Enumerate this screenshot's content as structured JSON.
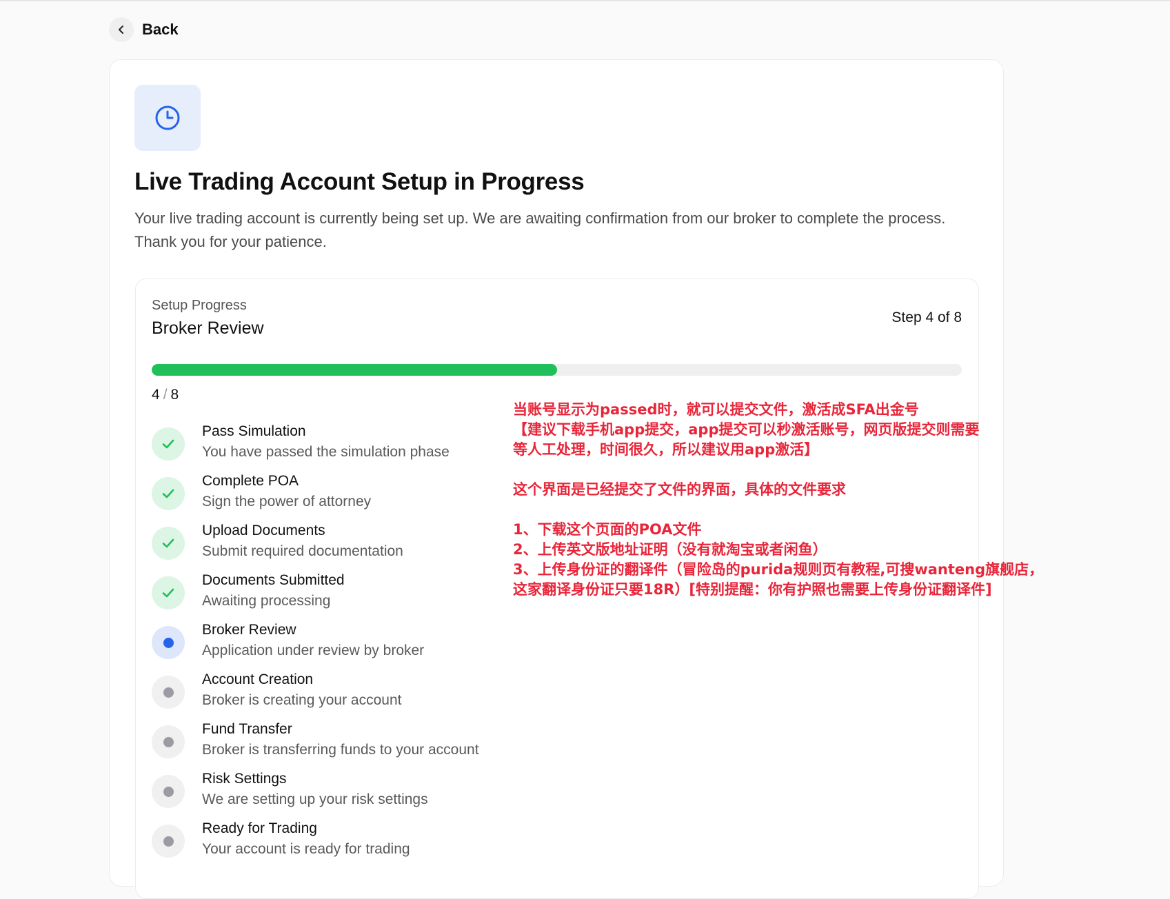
{
  "back": {
    "label": "Back"
  },
  "header": {
    "title": "Live Trading Account Setup in Progress",
    "description": "Your live trading account is currently being set up. We are awaiting confirmation from our broker to complete the process. Thank you for your patience."
  },
  "progress": {
    "label": "Setup Progress",
    "current_stage": "Broker Review",
    "step_text": "Step 4 of 8",
    "current": "4",
    "separator": "/",
    "total": "8",
    "fraction": 0.5,
    "fill_color": "#1fbf5a"
  },
  "steps": [
    {
      "title": "Pass Simulation",
      "subtitle": "You have passed the simulation phase",
      "status": "done"
    },
    {
      "title": "Complete POA",
      "subtitle": "Sign the power of attorney",
      "status": "done"
    },
    {
      "title": "Upload Documents",
      "subtitle": "Submit required documentation",
      "status": "done"
    },
    {
      "title": "Documents Submitted",
      "subtitle": "Awaiting processing",
      "status": "done"
    },
    {
      "title": "Broker Review",
      "subtitle": "Application under review by broker",
      "status": "current"
    },
    {
      "title": "Account Creation",
      "subtitle": "Broker is creating your account",
      "status": "pending"
    },
    {
      "title": "Fund Transfer",
      "subtitle": "Broker is transferring funds to your account",
      "status": "pending"
    },
    {
      "title": "Risk Settings",
      "subtitle": "We are setting up your risk settings",
      "status": "pending"
    },
    {
      "title": "Ready for Trading",
      "subtitle": "Your account is ready for trading",
      "status": "pending"
    }
  ],
  "annotation": {
    "color": "#e8263a",
    "lines": [
      "当账号显示为passed时，就可以提交文件，激活成SFA出金号",
      "【建议下载手机app提交，app提交可以秒激活账号，网页版提交则需要",
      "等人工处理，时间很久，所以建议用app激活】",
      "",
      "这个界面是已经提交了文件的界面，具体的文件要求",
      "",
      "1、下载这个页面的POA文件",
      "2、上传英文版地址证明（没有就淘宝或者闲鱼）",
      "3、上传身份证的翻译件（冒险岛的purida规则页有教程,可搜wanteng旗舰店，",
      "这家翻译身份证只要18R）[特别提醒：你有护照也需要上传身份证翻译件]"
    ]
  },
  "icons": {
    "back": "chevron-left-icon",
    "status": "clock-icon",
    "done": "check-icon",
    "current": "dot-icon",
    "pending": "dot-icon"
  },
  "colors": {
    "accent_blue": "#2563eb",
    "success_green": "#1fbf5a",
    "pending_gray": "#9b9ba3"
  }
}
